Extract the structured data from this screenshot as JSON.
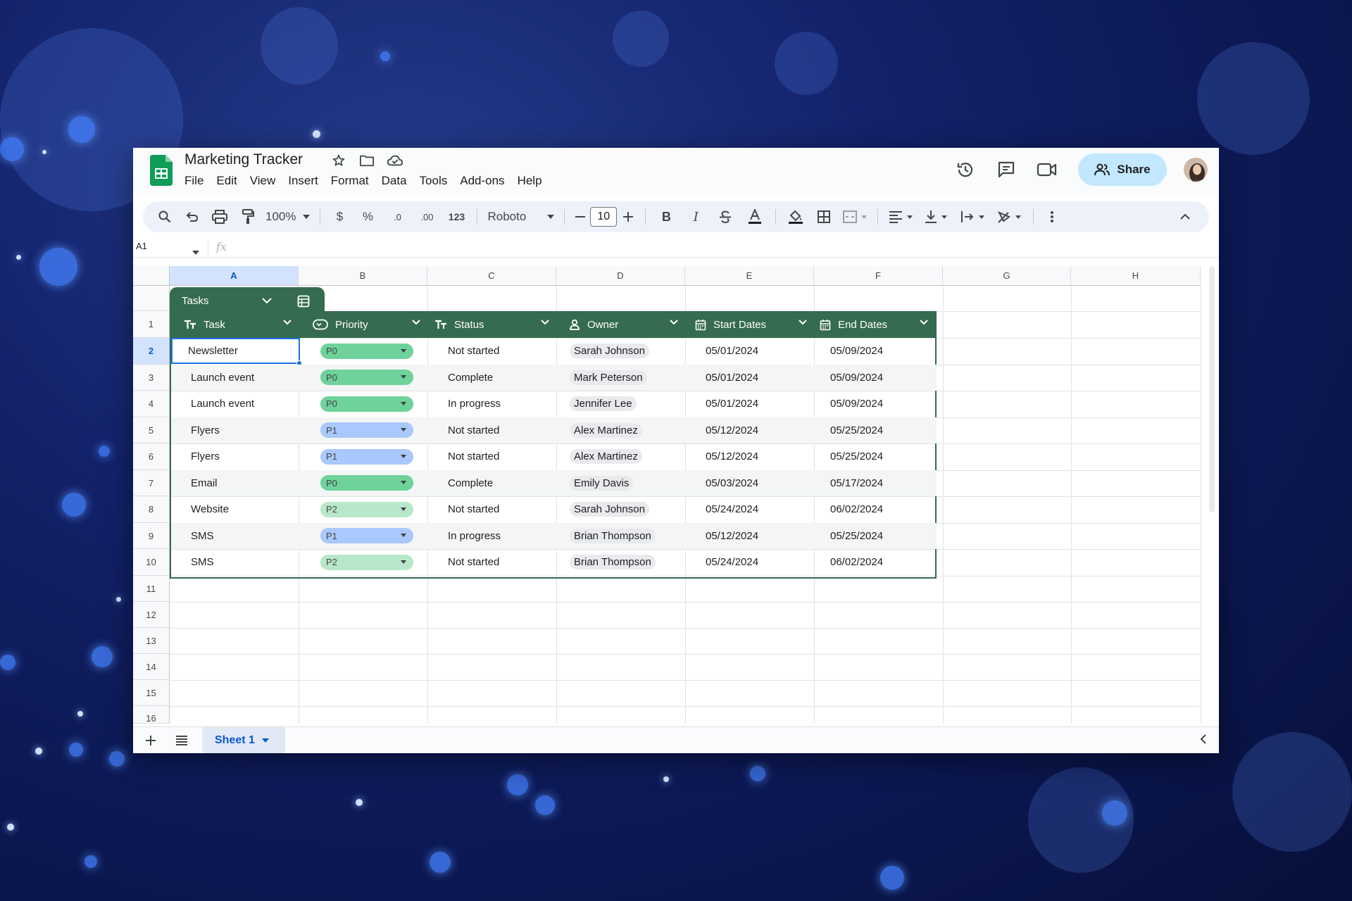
{
  "app": {
    "doc_title": "Marketing Tracker",
    "menu": [
      "File",
      "Edit",
      "View",
      "Insert",
      "Format",
      "Data",
      "Tools",
      "Add-ons",
      "Help"
    ],
    "share_label": "Share"
  },
  "toolbar": {
    "zoom": "100%",
    "currency": "$",
    "percent": "%",
    "decrease_decimal": ".0",
    "increase_decimal": ".00",
    "number_format": "123",
    "font": "Roboto",
    "font_size": "10",
    "bold": "B",
    "italic": "I"
  },
  "formula_bar": {
    "cell_ref": "A1",
    "fx": "fx",
    "value": ""
  },
  "columns": [
    "A",
    "B",
    "C",
    "D",
    "E",
    "F",
    "G",
    "H"
  ],
  "rows": [
    "1",
    "2",
    "3",
    "4",
    "5",
    "6",
    "7",
    "8",
    "9",
    "10",
    "11",
    "12",
    "13",
    "14",
    "15",
    "16"
  ],
  "table": {
    "name": "Tasks",
    "headers": [
      "Task",
      "Priority",
      "Status",
      "Owner",
      "Start Dates",
      "End Dates"
    ],
    "header_icons": [
      "text-type-icon",
      "dropdown-chip-icon",
      "text-type-icon",
      "person-icon",
      "calendar-icon",
      "calendar-icon"
    ],
    "rows": [
      {
        "task": "Newsletter",
        "priority": "P0",
        "status": "Not started",
        "owner": "Sarah Johnson",
        "start": "05/01/2024",
        "end": "05/09/2024"
      },
      {
        "task": "Launch event",
        "priority": "P0",
        "status": "Complete",
        "owner": "Mark Peterson",
        "start": "05/01/2024",
        "end": "05/09/2024"
      },
      {
        "task": "Launch event",
        "priority": "P0",
        "status": "In progress",
        "owner": "Jennifer Lee",
        "start": "05/01/2024",
        "end": "05/09/2024"
      },
      {
        "task": "Flyers",
        "priority": "P1",
        "status": "Not started",
        "owner": "Alex Martinez",
        "start": "05/12/2024",
        "end": "05/25/2024"
      },
      {
        "task": "Flyers",
        "priority": "P1",
        "status": "Not started",
        "owner": "Alex Martinez",
        "start": "05/12/2024",
        "end": "05/25/2024"
      },
      {
        "task": "Email",
        "priority": "P0",
        "status": "Complete",
        "owner": "Emily Davis",
        "start": "05/03/2024",
        "end": "05/17/2024"
      },
      {
        "task": "Website",
        "priority": "P2",
        "status": "Not started",
        "owner": "Sarah Johnson",
        "start": "05/24/2024",
        "end": "06/02/2024"
      },
      {
        "task": "SMS",
        "priority": "P1",
        "status": "In progress",
        "owner": "Brian Thompson",
        "start": "05/12/2024",
        "end": "05/25/2024"
      },
      {
        "task": "SMS",
        "priority": "P2",
        "status": "Not started",
        "owner": "Brian Thompson",
        "start": "05/24/2024",
        "end": "06/02/2024"
      }
    ]
  },
  "sheets": {
    "active": "Sheet 1"
  },
  "colors": {
    "table_header": "#356b4f",
    "p0": "#6ed29a",
    "p1": "#a9c8fb",
    "p2": "#b8e8c9",
    "selection": "#1a73e8",
    "share_button": "#c2e7ff"
  }
}
